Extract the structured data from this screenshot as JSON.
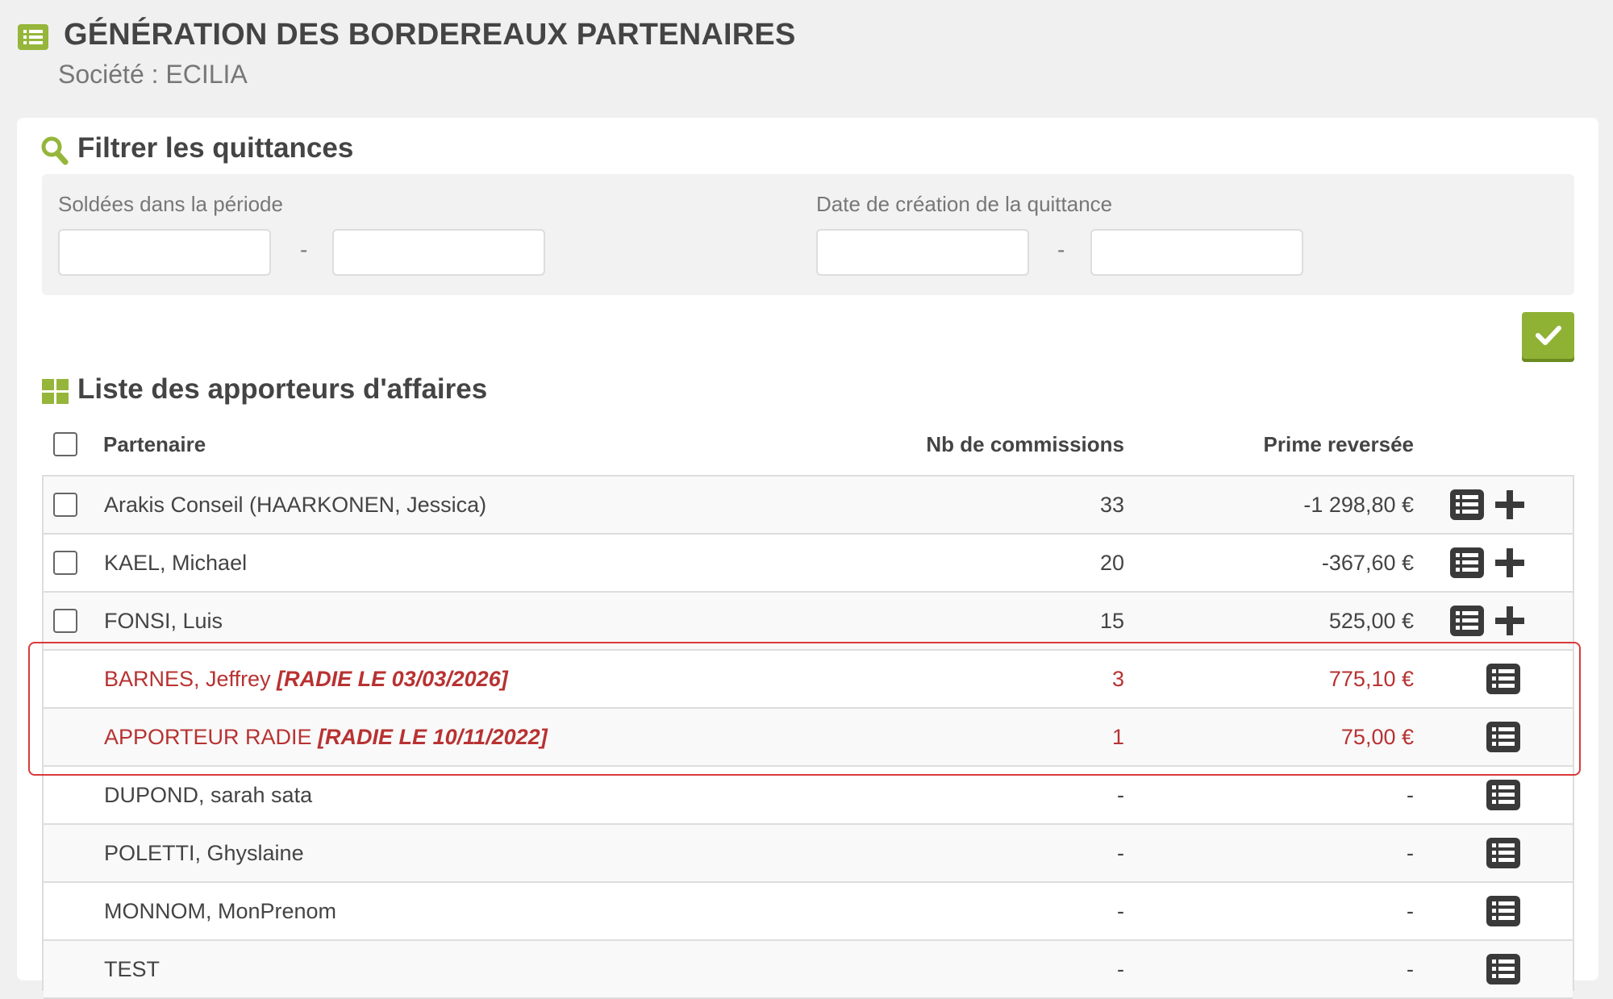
{
  "header": {
    "title": "GÉNÉRATION DES BORDEREAUX PARTENAIRES",
    "subtitle": "Société : ECILIA",
    "icon": "list-icon"
  },
  "filter": {
    "title": "Filtrer les quittances",
    "period_label": "Soldées dans la période",
    "creation_label": "Date de création de la quittance",
    "separator": "-",
    "period_from": "",
    "period_to": "",
    "creation_from": "",
    "creation_to": "",
    "validate_icon": "check-icon"
  },
  "list": {
    "title": "Liste des apporteurs d'affaires",
    "columns": {
      "partner": "Partenaire",
      "nb_commissions": "Nb de commissions",
      "prime": "Prime reversée"
    },
    "rows": [
      {
        "name": "Arakis Conseil (HAARKONEN, Jessica)",
        "tag": "",
        "nb": "33",
        "prime": "-1 298,80 €",
        "checkbox": true,
        "add": true,
        "radie": false
      },
      {
        "name": "KAEL, Michael",
        "tag": "",
        "nb": "20",
        "prime": "-367,60 €",
        "checkbox": true,
        "add": true,
        "radie": false
      },
      {
        "name": "FONSI, Luis",
        "tag": "",
        "nb": "15",
        "prime": "525,00 €",
        "checkbox": true,
        "add": true,
        "radie": false
      },
      {
        "name": "BARNES, Jeffrey ",
        "tag": "[RADIE LE 03/03/2026]",
        "nb": "3",
        "prime": "775,10 €",
        "checkbox": false,
        "add": false,
        "radie": true
      },
      {
        "name": "APPORTEUR RADIE ",
        "tag": "[RADIE LE 10/11/2022]",
        "nb": "1",
        "prime": "75,00 €",
        "checkbox": false,
        "add": false,
        "radie": true
      },
      {
        "name": "DUPOND, sarah sata",
        "tag": "",
        "nb": "-",
        "prime": "-",
        "checkbox": false,
        "add": false,
        "radie": false
      },
      {
        "name": "POLETTI, Ghyslaine",
        "tag": "",
        "nb": "-",
        "prime": "-",
        "checkbox": false,
        "add": false,
        "radie": false
      },
      {
        "name": "MONNOM, MonPrenom",
        "tag": "",
        "nb": "-",
        "prime": "-",
        "checkbox": false,
        "add": false,
        "radie": false
      },
      {
        "name": "TEST",
        "tag": "",
        "nb": "-",
        "prime": "-",
        "checkbox": false,
        "add": false,
        "radie": false
      }
    ]
  },
  "colors": {
    "accent_green": "#95b63a",
    "radie_red": "#b83232",
    "highlight_red": "#d93a3a"
  }
}
